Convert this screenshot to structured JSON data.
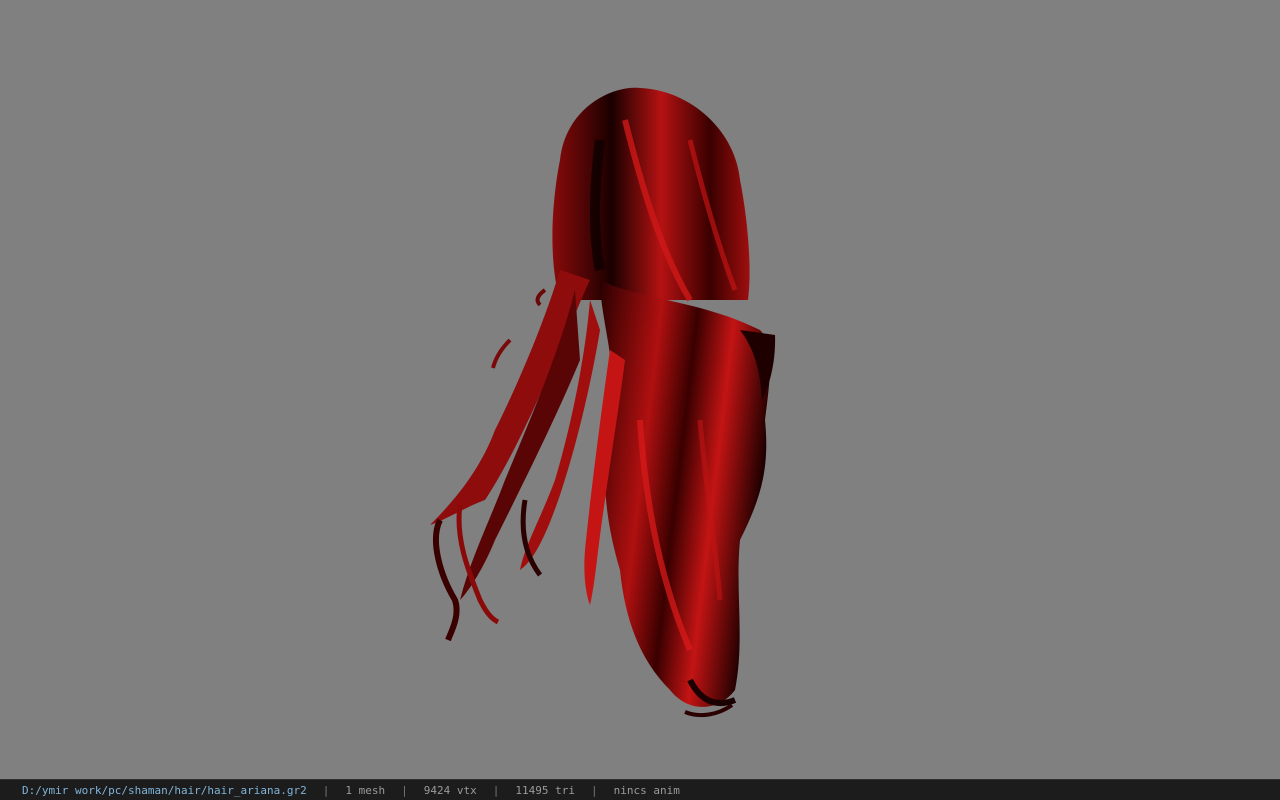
{
  "viewer": {
    "background_color": "#808080",
    "model_color": "#b01010",
    "model_shadow_color": "#1a0000",
    "model_icon": "hair-model"
  },
  "status": {
    "file_path": "D:/ymir work/pc/shaman/hair/hair_ariana.gr2",
    "separator": "|",
    "mesh_count": "1 mesh",
    "vertex_count": "9424 vtx",
    "triangle_count": "11495 tri",
    "anim_status": "nincs anim"
  }
}
